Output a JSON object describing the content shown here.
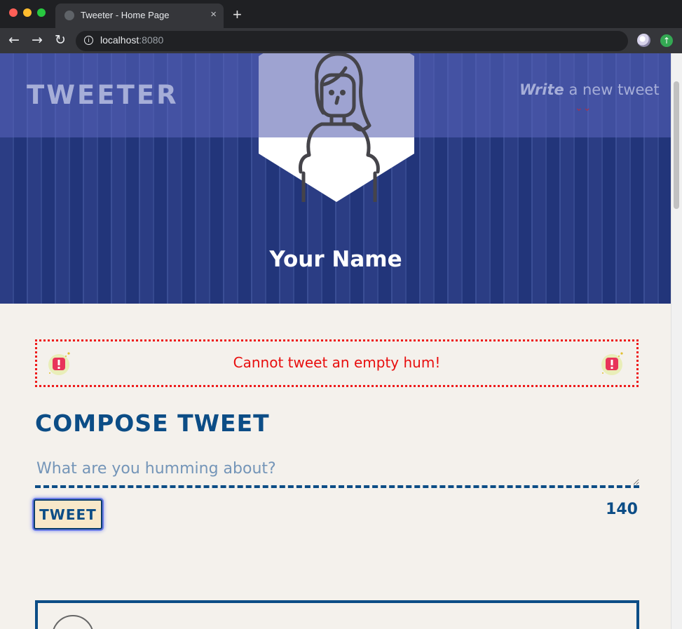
{
  "browser": {
    "tab_title": "Tweeter - Home Page",
    "tab_close": "×",
    "new_tab": "+",
    "url_host": "localhost",
    "url_port": ":8080",
    "nav_back": "←",
    "nav_forward": "→",
    "nav_reload": "↻",
    "info_glyph": "i",
    "star_glyph": "★",
    "update_glyph": "↑"
  },
  "header": {
    "brand": "TWEETER",
    "write_em": "Write",
    "write_rest": " a new tweet",
    "chevron_glyph": "⌄⌄",
    "profile_name": "Your Name"
  },
  "error": {
    "message": "Cannot tweet an empty hum!"
  },
  "compose": {
    "title": "COMPOSE TWEET",
    "placeholder": "What are you humming about?",
    "button_label": "TWEET",
    "counter": "140"
  },
  "colors": {
    "navy": "#0c4d86",
    "error_red": "#ee1b1b",
    "page_bg": "#f4f1ec",
    "hero_blue": "#2b3d84",
    "button_bg": "#f8e8c9"
  }
}
